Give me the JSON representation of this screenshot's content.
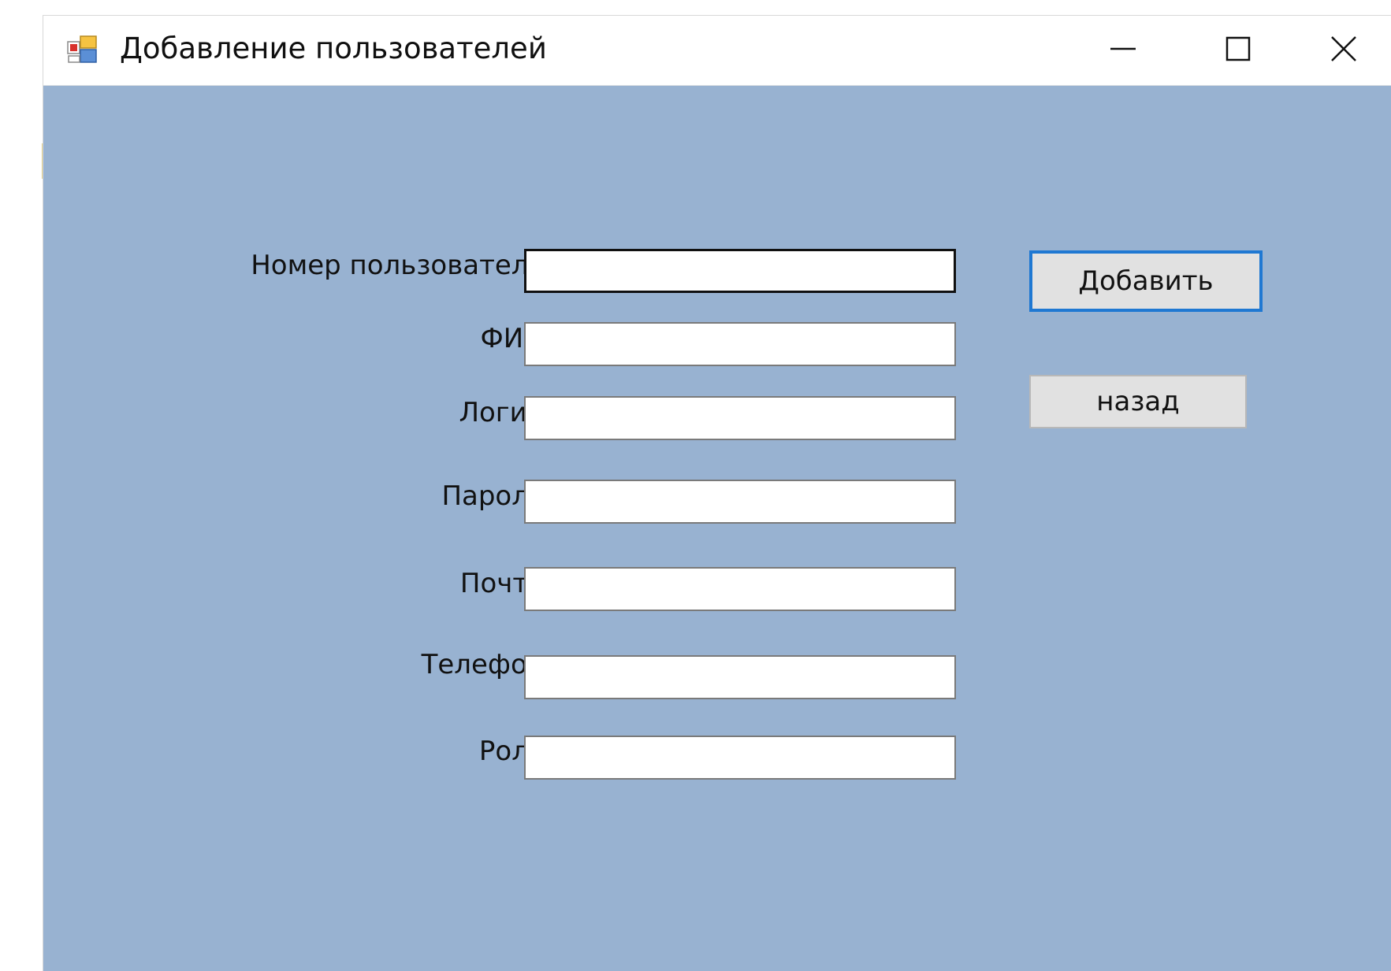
{
  "window": {
    "title": "Добавление пользователей",
    "app_icon": "winforms-app-icon",
    "controls": {
      "minimize_icon": "minimize-icon",
      "maximize_icon": "maximize-icon",
      "close_icon": "close-icon"
    },
    "client_background": "#98b2d1"
  },
  "form": {
    "fields": [
      {
        "key": "user_id",
        "label": "Номер пользователя",
        "value": "",
        "focused": true
      },
      {
        "key": "fio",
        "label": "ФИО",
        "value": ""
      },
      {
        "key": "login",
        "label": "Логин",
        "value": ""
      },
      {
        "key": "password",
        "label": "Пароль",
        "value": ""
      },
      {
        "key": "email",
        "label": "Почта",
        "value": ""
      },
      {
        "key": "phone",
        "label": "Телефон",
        "value": ""
      },
      {
        "key": "role",
        "label": "Роль",
        "value": ""
      }
    ]
  },
  "actions": {
    "add_label": "Добавить",
    "back_label": "назад",
    "focus_color": "#1f78d2"
  }
}
